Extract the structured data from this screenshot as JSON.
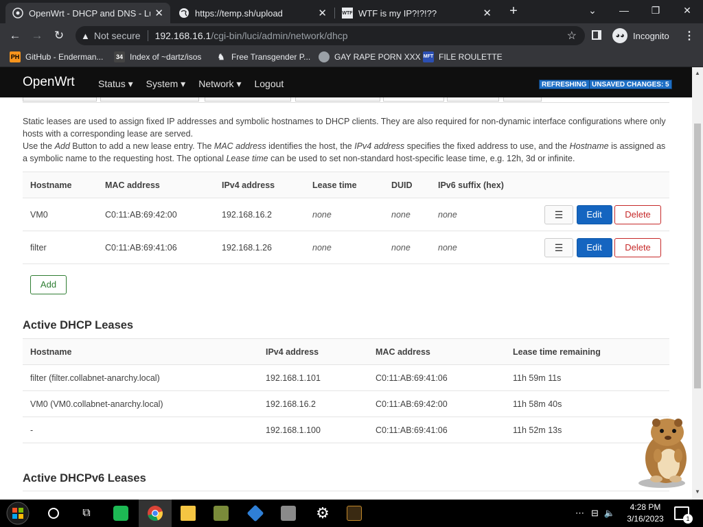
{
  "browser": {
    "tabs": [
      {
        "title": "OpenWrt - DHCP and DNS - LuCI",
        "icon": "openwrt-favicon-icon",
        "active": true
      },
      {
        "title": "https://temp.sh/upload",
        "icon": "globe-icon",
        "active": false
      },
      {
        "title": "WTF is my IP?!?!??",
        "icon": "wtf-favicon-icon",
        "active": false
      }
    ],
    "not_secure_label": "Not secure",
    "url_host": "192.168.16.1",
    "url_path": "/cgi-bin/luci/admin/network/dhcp",
    "incognito_label": "Incognito",
    "bookmarks": [
      {
        "label": "GitHub - Enderman...",
        "icon": "PH",
        "color": "#f7941d"
      },
      {
        "label": "Index of ~dartz/isos",
        "icon": "34",
        "color": "#444444"
      },
      {
        "label": "Free Transgender P...",
        "icon": "bot",
        "color": "#555555"
      },
      {
        "label": "GAY RAPE PORN XXX",
        "icon": "globe",
        "color": "#555555"
      },
      {
        "label": "FILE ROULETTE",
        "icon": "MFT",
        "color": "#2b4fb3"
      }
    ]
  },
  "header": {
    "brand": "OpenWrt",
    "menu": [
      "Status ▾",
      "System ▾",
      "Network ▾",
      "Logout"
    ],
    "badge_refreshing": "REFRESHING",
    "badge_unsaved": "UNSAVED CHANGES: 5"
  },
  "description": {
    "p1": "Static leases are used to assign fixed IP addresses and symbolic hostnames to DHCP clients. They are also required for non-dynamic interface configurations where only hosts with a corresponding lease are served.",
    "p2_a": "Use the ",
    "p2_add": "Add",
    "p2_b": " Button to add a new lease entry. The ",
    "p2_mac": "MAC address",
    "p2_c": " identifies the host, the ",
    "p2_ipv4": "IPv4 address",
    "p2_d": " specifies the fixed address to use, and the ",
    "p2_host": "Hostname",
    "p2_e": " is assigned as a symbolic name to the requesting host. The optional ",
    "p2_lease": "Lease time",
    "p2_f": " can be used to set non-standard host-specific lease time, e.g. 12h, 3d or infinite."
  },
  "static_leases": {
    "columns": [
      "Hostname",
      "MAC address",
      "IPv4 address",
      "Lease time",
      "DUID",
      "IPv6 suffix (hex)"
    ],
    "rows": [
      {
        "hostname": "VM0",
        "mac": "C0:11:AB:69:42:00",
        "ipv4": "192.168.16.2",
        "lease": "none",
        "duid": "none",
        "ipv6": "none"
      },
      {
        "hostname": "filter",
        "mac": "C0:11:AB:69:41:06",
        "ipv4": "192.168.1.26",
        "lease": "none",
        "duid": "none",
        "ipv6": "none"
      }
    ],
    "edit_label": "Edit",
    "delete_label": "Delete",
    "menu_label": "☰",
    "add_label": "Add"
  },
  "active_leases": {
    "title": "Active DHCP Leases",
    "columns": [
      "Hostname",
      "IPv4 address",
      "MAC address",
      "Lease time remaining"
    ],
    "rows": [
      {
        "hostname": "filter (filter.collabnet-anarchy.local)",
        "ipv4": "192.168.1.101",
        "mac": "C0:11:AB:69:41:06",
        "remaining": "11h 59m 11s"
      },
      {
        "hostname": "VM0 (VM0.collabnet-anarchy.local)",
        "ipv4": "192.168.16.2",
        "mac": "C0:11:AB:69:42:00",
        "remaining": "11h 58m 40s"
      },
      {
        "hostname": "-",
        "ipv4": "192.168.1.100",
        "mac": "C0:11:AB:69:41:06",
        "remaining": "11h 52m 13s"
      }
    ]
  },
  "active_leases_v6": {
    "title": "Active DHCPv6 Leases"
  },
  "taskbar": {
    "time": "4:28 PM",
    "date": "3/16/2023",
    "notification_count": "1"
  }
}
